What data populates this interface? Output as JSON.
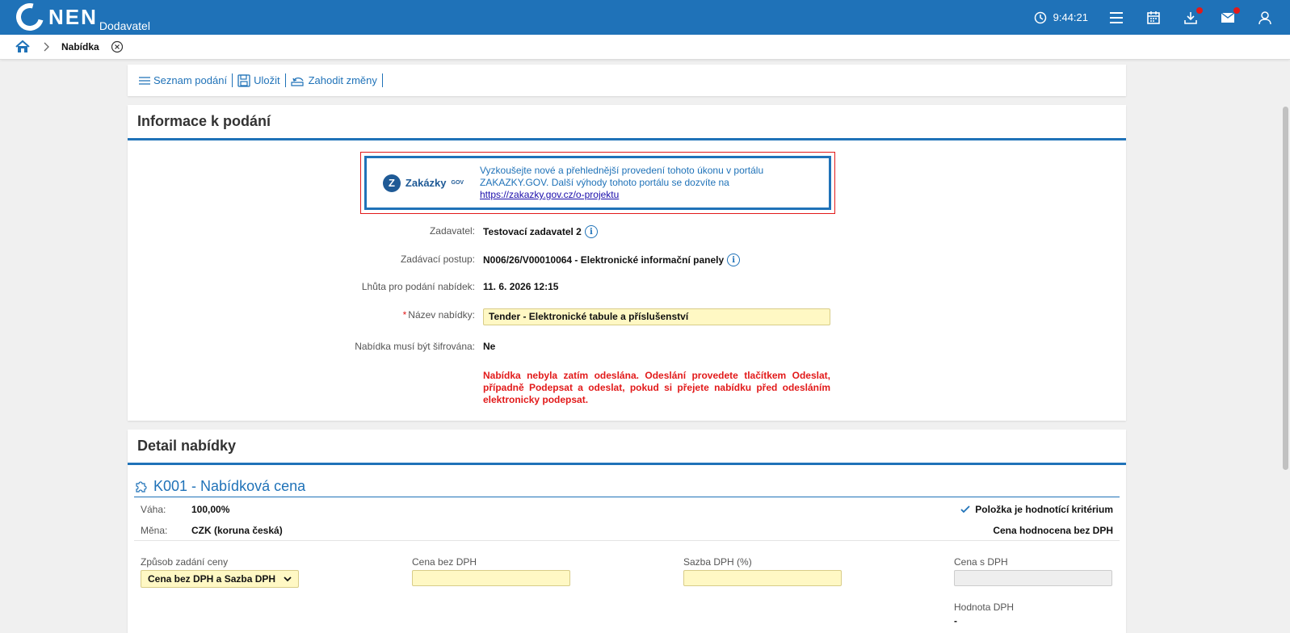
{
  "app": {
    "logo": "NEN",
    "role": "Dodavatel",
    "time": "9:44:21"
  },
  "breadcrumb": {
    "title": "Nabídka"
  },
  "toolbar": {
    "list": "Seznam podání",
    "save": "Uložit",
    "discard": "Zahodit změny"
  },
  "info": {
    "heading": "Informace k podání",
    "banner": {
      "brand": "Zakázky",
      "brand_sup": "GOV",
      "text": "Vyzkoušejte nové a přehlednější provedení tohoto úkonu v portálu ZAKAZKY.GOV. Další výhody tohoto portálu se dozvíte na",
      "link": "https://zakazky.gov.cz/o-projektu"
    },
    "fields": {
      "zadavatel_label": "Zadavatel:",
      "zadavatel_value": "Testovací zadavatel 2",
      "postup_label": "Zadávací postup:",
      "postup_value": "N006/26/V00010064 - Elektronické informační panely",
      "lhuta_label": "Lhůta pro podání nabídek:",
      "lhuta_value": "11. 6. 2026 12:15",
      "nazev_label": "Název nabídky:",
      "nazev_value": "Tender - Elektronické tabule a příslušenství",
      "sifrovana_label": "Nabídka musí být šifrována:",
      "sifrovana_value": "Ne"
    },
    "warning": "Nabídka nebyla zatím odeslána. Odeslání provedete tlačítkem Odeslat, případně Podepsat a odeslat, pokud si přejete nabídku před odesláním elektronicky podepsat."
  },
  "detail": {
    "heading": "Detail nabídky",
    "criterion_title": "K001 - Nabídková cena",
    "vaha_label": "Váha:",
    "vaha_value": "100,00%",
    "mena_label": "Měna:",
    "mena_value": "CZK (koruna česká)",
    "hodnotici": "Položka je hodnotící kritérium",
    "bez_dph": "Cena hodnocena bez DPH",
    "zpusob_label": "Způsob zadání ceny",
    "zpusob_value": "Cena bez DPH a Sazba DPH",
    "cena_bez_label": "Cena bez DPH",
    "sazba_label": "Sazba DPH (%)",
    "cena_s_label": "Cena s DPH",
    "hodnota_label": "Hodnota DPH",
    "hodnota_value": "-"
  },
  "colors": {
    "brand": "#1f72b8",
    "warning": "#e21a1a",
    "input_bg": "#fff8c4"
  }
}
